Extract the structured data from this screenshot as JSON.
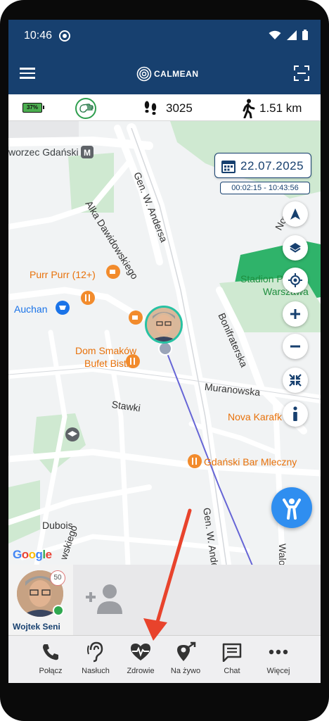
{
  "status_bar": {
    "time": "10:46"
  },
  "app_bar": {
    "logo_text": "CALMEAN"
  },
  "stats": {
    "battery": "37%",
    "steps": "3025",
    "distance": "1.51 km"
  },
  "map": {
    "date": "22.07.2025",
    "time_range": "00:02:15 - 10:43:56",
    "labels": {
      "station": "worzec Gdański",
      "alka": "Alka Dawidowskiego",
      "gen_top": "Gen. W. Andersa",
      "purr": "Purr Purr (12+)",
      "auchan": "Auchan",
      "stadion": "Stadion P",
      "warszawa": "Warszawa",
      "stadion_tail": "i",
      "dom": "Dom Smaków",
      "bufet": "Bufet Bistro",
      "bonif": "Bonifraterska",
      "muranowska": "Muranowska",
      "stawki": "Stawki",
      "nova": "Nova Karafk",
      "gdanski_bar": "Gdański Bar Mleczny",
      "dubois": "Dubois",
      "gen_bottom": "Gen. W. Andersa",
      "skiego": "wskiego",
      "walo": "Walo",
      "nowy": "Nowy",
      "google": "Google"
    }
  },
  "contact": {
    "name": "Wojtek Seni",
    "badge": "50"
  },
  "bottom_nav": [
    {
      "label": "Połącz",
      "icon": "phone-icon"
    },
    {
      "label": "Nasłuch",
      "icon": "ear-icon"
    },
    {
      "label": "Zdrowie",
      "icon": "heart-pulse-icon"
    },
    {
      "label": "Na żywo",
      "icon": "live-location-icon"
    },
    {
      "label": "Chat",
      "icon": "chat-icon"
    },
    {
      "label": "Więcej",
      "icon": "more-icon"
    }
  ],
  "colors": {
    "brand": "#17406f",
    "accent_blue": "#2f8ef0",
    "annotation_arrow": "#e8432c",
    "online": "#2fa84f"
  }
}
